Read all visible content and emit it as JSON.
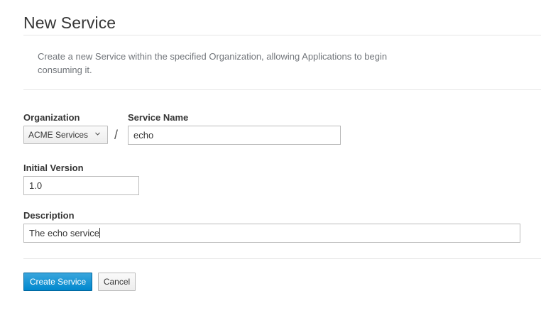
{
  "page": {
    "title": "New Service",
    "description": "Create a new Service within the specified Organization, allowing Applications to begin consuming it."
  },
  "form": {
    "organization": {
      "label": "Organization",
      "selected": "ACME Services"
    },
    "separator": "/",
    "service_name": {
      "label": "Service Name",
      "value": "echo"
    },
    "initial_version": {
      "label": "Initial Version",
      "value": "1.0"
    },
    "description": {
      "label": "Description",
      "value": "The echo service"
    }
  },
  "actions": {
    "create_label": "Create Service",
    "cancel_label": "Cancel"
  },
  "colors": {
    "primary": "#0088ce",
    "text": "#363636",
    "muted": "#72767b"
  },
  "icons": {
    "dropdown": "chevron-down-icon"
  }
}
